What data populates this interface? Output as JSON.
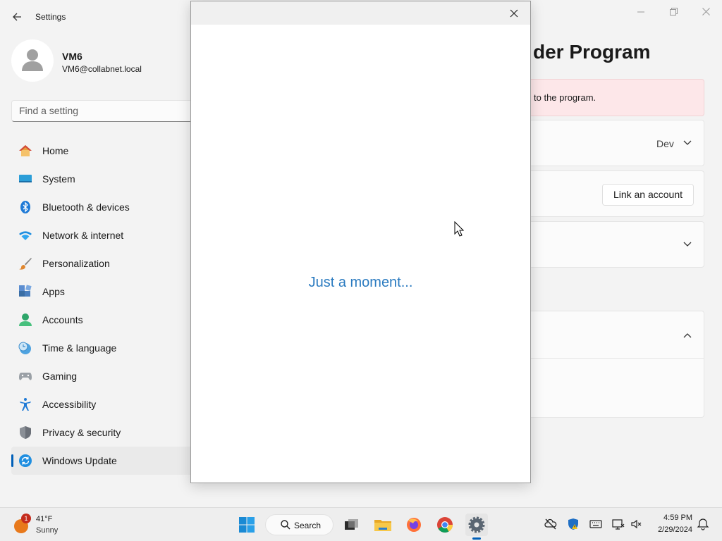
{
  "settings": {
    "app_title": "Settings",
    "profile": {
      "name": "VM6",
      "email": "VM6@collabnet.local"
    },
    "search_placeholder": "Find a setting",
    "nav_items": [
      {
        "label": "Home",
        "icon": "home-icon"
      },
      {
        "label": "System",
        "icon": "system-icon"
      },
      {
        "label": "Bluetooth & devices",
        "icon": "bluetooth-icon"
      },
      {
        "label": "Network & internet",
        "icon": "wifi-icon"
      },
      {
        "label": "Personalization",
        "icon": "brush-icon"
      },
      {
        "label": "Apps",
        "icon": "apps-icon"
      },
      {
        "label": "Accounts",
        "icon": "accounts-icon"
      },
      {
        "label": "Time & language",
        "icon": "clock-globe-icon"
      },
      {
        "label": "Gaming",
        "icon": "gamepad-icon"
      },
      {
        "label": "Accessibility",
        "icon": "accessibility-icon"
      },
      {
        "label": "Privacy & security",
        "icon": "shield-icon"
      },
      {
        "label": "Windows Update",
        "icon": "update-icon",
        "selected": true
      }
    ],
    "page_heading_partial": "der Program",
    "alert_text_partial": "to the program.",
    "channel_value": "Dev",
    "link_account_label": "Link an account"
  },
  "dialog": {
    "message": "Just a moment..."
  },
  "taskbar": {
    "weather": {
      "temp": "41°F",
      "condition": "Sunny",
      "badge": "1"
    },
    "search_label": "Search",
    "apps": [
      "task-view-icon",
      "file-explorer-icon",
      "firefox-icon",
      "chrome-icon",
      "settings-icon"
    ],
    "time": "4:59 PM",
    "date": "2/29/2024"
  },
  "colors": {
    "accent": "#005fb8",
    "dialog_text": "#2b7bc0",
    "alert_bg": "#fde7e9"
  }
}
